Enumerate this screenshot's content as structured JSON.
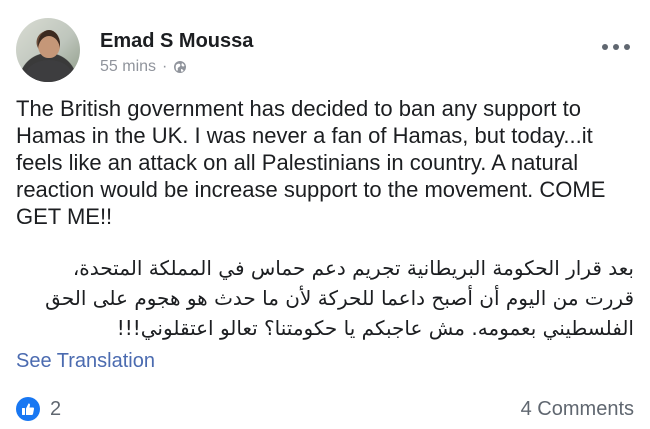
{
  "post": {
    "author": {
      "name": "Emad S Moussa",
      "avatar": "profile-photo"
    },
    "meta": {
      "time": "55 mins",
      "separator": "·",
      "privacy_icon": "globe-icon"
    },
    "menu_icon": "more-options-icon",
    "text_en": "The British government has decided to ban any support to Hamas in the UK. I was never a fan of Hamas, but today...it feels like an attack on all Palestinians in country. A natural reaction would be increase support to the movement. COME GET ME!!",
    "text_ar_lines": [
      "بعد قرار الحكومة البريطانية تجريم دعم حماس في المملكة المتحدة،",
      "قررت من اليوم أن أصبح داعما للحركة لأن ما حدث هو هجوم على الحق",
      "الفلسطيني بعمومه. مش عاجبكم يا حكومتنا؟ تعالو اعتقلوني!!!"
    ],
    "see_translation": "See Translation",
    "reactions": {
      "icon": "like-icon",
      "count": "2",
      "color": "#1877f2"
    },
    "comments": "4 Comments"
  },
  "colors": {
    "link": "#4b6bb0",
    "secondary_text": "#90949c"
  }
}
